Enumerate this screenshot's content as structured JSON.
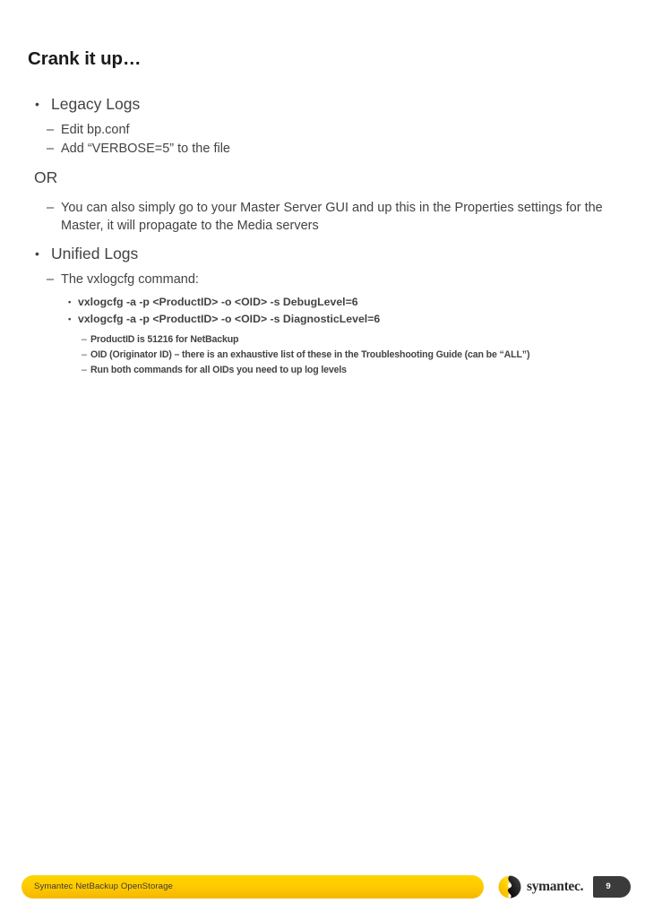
{
  "slide": {
    "title": "Crank it up…",
    "body": [
      {
        "level": 1,
        "marker": "•",
        "text": "Legacy Logs"
      },
      {
        "level": 2,
        "marker": "–",
        "text": "Edit bp.conf"
      },
      {
        "level": 2,
        "marker": "–",
        "text": "Add “VERBOSE=5” to the file"
      },
      {
        "level": 1,
        "marker": "",
        "text": "OR"
      },
      {
        "level": 2,
        "marker": "–",
        "text": "You can also simply go to your Master Server GUI and up this in the Properties settings for the Master, it will propagate to the Media servers"
      },
      {
        "level": 1,
        "marker": "•",
        "text": "Unified Logs"
      },
      {
        "level": 2,
        "marker": "–",
        "text": "The vxlogcfg command:"
      },
      {
        "level": 3,
        "marker": "•",
        "text": "vxlogcfg -a -p <ProductID> -o <OID> -s DebugLevel=6"
      },
      {
        "level": 3,
        "marker": "•",
        "text": "vxlogcfg -a -p <ProductID> -o <OID> -s DiagnosticLevel=6"
      },
      {
        "level": 4,
        "marker": "–",
        "text": "ProductID is 51216 for NetBackup"
      },
      {
        "level": 4,
        "marker": "–",
        "text": "OID (Originator ID) – there is an exhaustive list of these in the Troubleshooting Guide (can be “ALL”)"
      },
      {
        "level": 4,
        "marker": "–",
        "text": "Run both commands for all OIDs you need to up log levels"
      }
    ]
  },
  "footer": {
    "bar_label": "Symantec NetBackup OpenStorage",
    "brand_name": "symantec.",
    "slide_number": "9",
    "colors": {
      "bar_yellow": "#FFCB00",
      "bar_yellow_dark": "#F5B700",
      "brand_black": "#2B2B2B",
      "slide_badge": "#3B3B3B",
      "body_text": "#434343",
      "title_text": "#1A1A1A"
    }
  }
}
